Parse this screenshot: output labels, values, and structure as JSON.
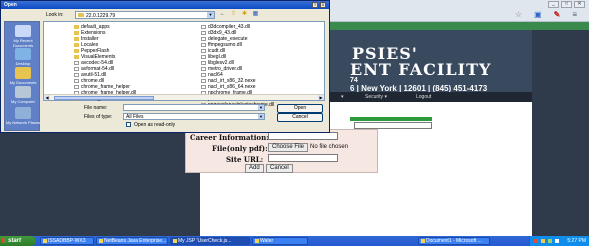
{
  "browser": {
    "window_buttons": [
      "_",
      "□",
      "✕"
    ],
    "toolbar_icons": [
      "☆",
      "▣",
      "✎",
      "≡"
    ]
  },
  "site": {
    "banner_title": "PSIES'",
    "banner_sub": "ENT FACILITY",
    "banner_num": "74",
    "banner_contact": "6 | New York | 12601 | (845) 451-4173",
    "nav": [
      "▾",
      "Security ▾",
      "Logout"
    ],
    "form": {
      "career_label": "Career Information:",
      "file_label": "File(only pdf):",
      "choose_file": "Choose File",
      "no_file": "No file chosen",
      "site_url_label": "Site URL:",
      "add_button": "Add",
      "cancel_button": "Cancel"
    }
  },
  "dialog": {
    "title": "Open",
    "controls": [
      "?",
      "X"
    ],
    "look_in_label": "Look in:",
    "look_in_value": "22.0.1229.79",
    "toolbar_icons": [
      "←",
      "⇧",
      "✱",
      "▦"
    ],
    "places": [
      "My Recent Documents",
      "Desktop",
      "My Documents",
      "My Computer",
      "My Network Places"
    ],
    "files_col1": [
      "default_apps",
      "Extensions",
      "Installer",
      "Locales",
      "PepperFlash",
      "VisualElements",
      "avcodec-54.dll",
      "avformat-54.dll",
      "avutil-51.dll",
      "chrome.dll",
      "chrome_frame_helper",
      "chrome_frame_helper.dll",
      "chrome_launcher"
    ],
    "files_col2": [
      "d3dcompiler_43.dll",
      "d3dx9_43.dll",
      "delegate_execute",
      "ffmpegsumo.dll",
      "icudt.dll",
      "libegl.dll",
      "libglesv2.dll",
      "metro_driver.dll",
      "nacl64",
      "nacl_irt_x86_32.nexe",
      "nacl_irt_x86_64.nexe",
      "npchrome_frame.dll",
      "pdf.dll",
      "ppgooglenaclpluginchrome.dll"
    ],
    "file_name_label": "File name:",
    "file_name_value": "",
    "files_of_type_label": "Files of type:",
    "files_of_type_value": "All Files",
    "open_button": "Open",
    "cancel_button": "Cancel",
    "readonly_label": "Open as read-only"
  },
  "taskbar": {
    "start": "start",
    "items": [
      "ISSADBBP-WX3",
      "NetBeans Java Enterprise...",
      "My JSP 'UserCheck.js...",
      "Water",
      "Document1 - Microsoft ..."
    ],
    "clock": "5:27 PM"
  }
}
